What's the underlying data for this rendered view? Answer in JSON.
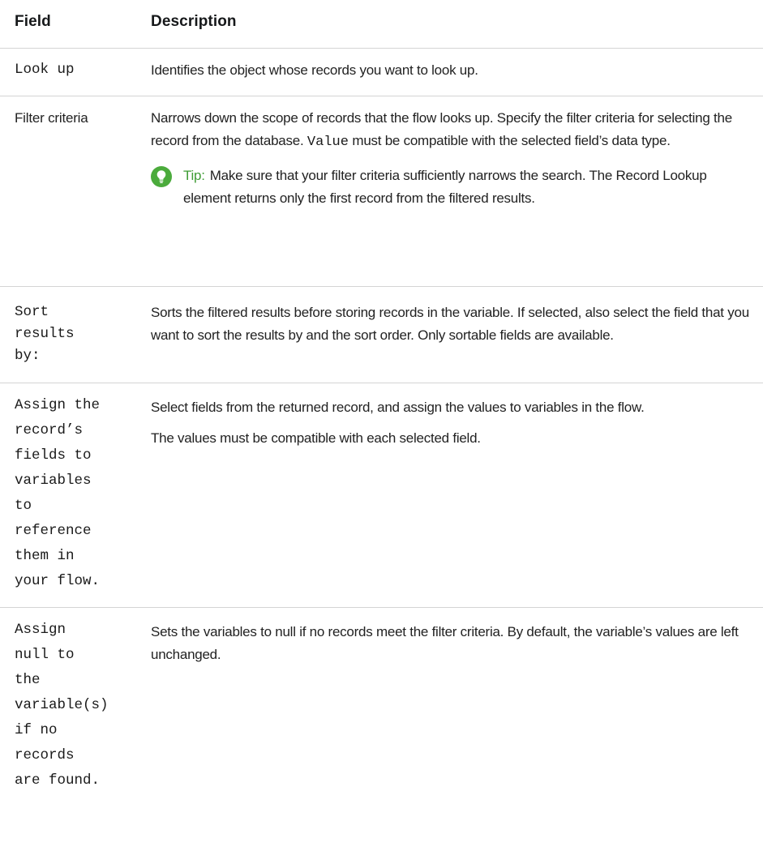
{
  "table": {
    "headers": {
      "field": "Field",
      "description": "Description"
    },
    "rows": [
      {
        "field": "Look up",
        "description": "Identifies the object whose records you want to look up."
      },
      {
        "field": "Filter criteria",
        "description_before": "Narrows down the scope of records that the flow looks up. Specify the filter criteria for selecting the record from the database.",
        "description_code": "Value",
        "description_after": "must be compatible with the selected field’s data type.",
        "tip": {
          "label": "Tip:",
          "text": "Make sure that your filter criteria sufficiently narrows the search. The Record Lookup element returns only the first record from the filtered results.",
          "icon": "lightbulb-icon"
        }
      },
      {
        "field_lines": [
          "Sort",
          "results",
          "by:"
        ],
        "description": "Sorts the filtered results before storing records in the variable. If selected, also select the field that you want to sort the results by and the sort order. Only sortable fields are available."
      },
      {
        "field_lines": [
          "Assign the",
          "record’s",
          "fields to",
          "variables",
          "to",
          "reference",
          "them in",
          "your flow."
        ],
        "description": "Select fields from the returned record, and assign the values to variables in the flow.",
        "description_2": "The values must be compatible with each selected field."
      },
      {
        "field_lines": [
          "Assign",
          "null to",
          "the",
          "variable(s)",
          "if no",
          "records",
          "are found."
        ],
        "description": "Sets the variables to null if no records meet the filter criteria. By default, the variable’s values are left unchanged."
      }
    ]
  },
  "colors": {
    "tip_green": "#3f9c35",
    "icon_green": "#4bab3c",
    "rule": "#d4d4d4"
  }
}
